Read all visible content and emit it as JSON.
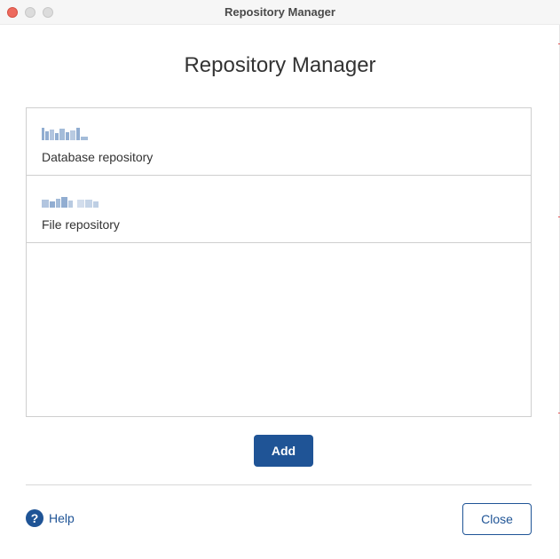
{
  "window": {
    "title": "Repository Manager"
  },
  "main": {
    "heading": "Repository Manager",
    "repositories": [
      {
        "name": "[redacted]",
        "type": "Database repository"
      },
      {
        "name": "[redacted]",
        "type": "File repository"
      }
    ],
    "add_label": "Add"
  },
  "footer": {
    "help_icon": "question-circle-icon",
    "help_label": "Help",
    "close_label": "Close"
  },
  "colors": {
    "accent": "#1f5496",
    "border": "#cfcfcf",
    "close_dot": "#ed6a5e"
  }
}
